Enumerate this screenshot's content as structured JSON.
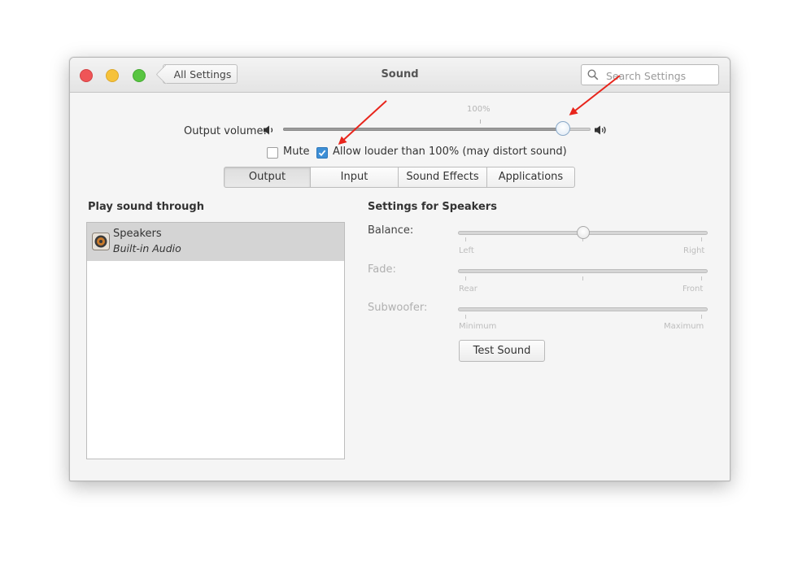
{
  "window": {
    "title": "Sound",
    "back_label": "All Settings",
    "search_placeholder": "Search Settings"
  },
  "volume": {
    "label": "Output volume:",
    "percent_of_max": 91,
    "mark_label": "100%",
    "mute_label": "Mute",
    "mute_checked": false,
    "allow_louder_label": "Allow louder than 100% (may distort sound)",
    "allow_louder_checked": true
  },
  "tabs": [
    {
      "label": "Output",
      "active": true
    },
    {
      "label": "Input",
      "active": false
    },
    {
      "label": "Sound Effects",
      "active": false
    },
    {
      "label": "Applications",
      "active": false
    }
  ],
  "play_through": {
    "header": "Play sound through",
    "devices": [
      {
        "name": "Speakers",
        "subtitle": "Built-in Audio",
        "selected": true
      }
    ]
  },
  "speaker_settings": {
    "header": "Settings for Speakers",
    "balance": {
      "label": "Balance:",
      "left_label": "Left",
      "right_label": "Right",
      "position": 0.5
    },
    "fade": {
      "label": "Fade:",
      "left_label": "Rear",
      "right_label": "Front"
    },
    "subwoofer": {
      "label": "Subwoofer:",
      "left_label": "Minimum",
      "right_label": "Maximum"
    },
    "test_button": "Test Sound"
  },
  "colors": {
    "accent": "#3d8fd6",
    "annotation_arrow": "#e8251c"
  },
  "icons": {
    "volume_low": "speaker-low-icon",
    "volume_high": "speaker-high-icon",
    "search": "magnifier-icon",
    "device": "speaker-device-icon"
  }
}
